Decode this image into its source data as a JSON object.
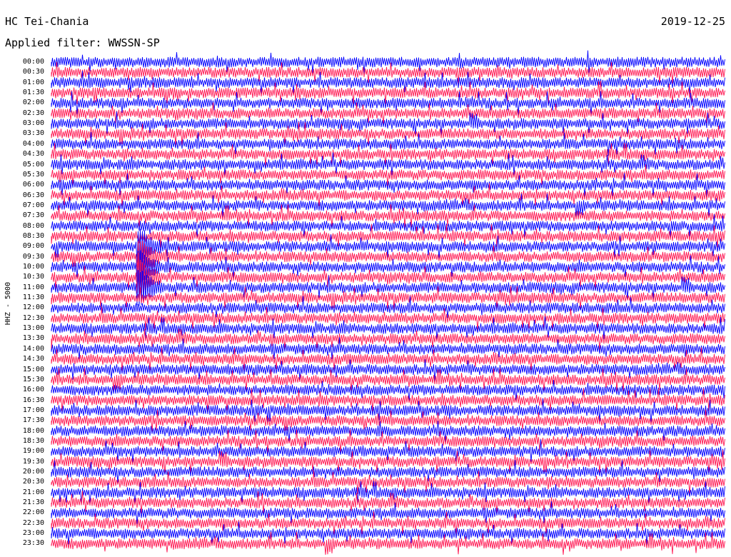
{
  "header": {
    "station": "HC Tei-Chania",
    "date": "2019-12-25",
    "filter_prefix": "Applied filter:",
    "filter_name": "WWSSN-SP"
  },
  "channel_label": "HHZ - 5000",
  "colors": {
    "trace_a": "#0000ff",
    "trace_b": "#ff1450",
    "background": "#ffffff",
    "text": "#000000"
  },
  "chart_data": {
    "type": "line",
    "title": "HC Tei-Chania",
    "subtitle": "Applied filter: WWSSN-SP",
    "ylabel": "HHZ - 5000",
    "row_labels": [
      "00:00",
      "00:30",
      "01:00",
      "01:30",
      "02:00",
      "02:30",
      "03:00",
      "03:30",
      "04:00",
      "04:30",
      "05:00",
      "05:30",
      "06:00",
      "06:30",
      "07:00",
      "07:30",
      "08:00",
      "08:30",
      "09:00",
      "09:30",
      "10:00",
      "10:30",
      "11:00",
      "11:30",
      "12:00",
      "12:30",
      "13:00",
      "13:30",
      "14:00",
      "14:30",
      "15:00",
      "15:30",
      "16:00",
      "16:30",
      "17:00",
      "17:30",
      "18:00",
      "18:30",
      "19:00",
      "19:30",
      "20:00",
      "20:30",
      "21:00",
      "21:30",
      "22:00",
      "22:30",
      "23:00",
      "23:30"
    ],
    "row_minutes": 30,
    "series_colors": [
      "#0000ff",
      "#ff1450"
    ],
    "event": {
      "row_start": "09:00",
      "row_end": "11:00",
      "minute_offset": 4
    }
  }
}
